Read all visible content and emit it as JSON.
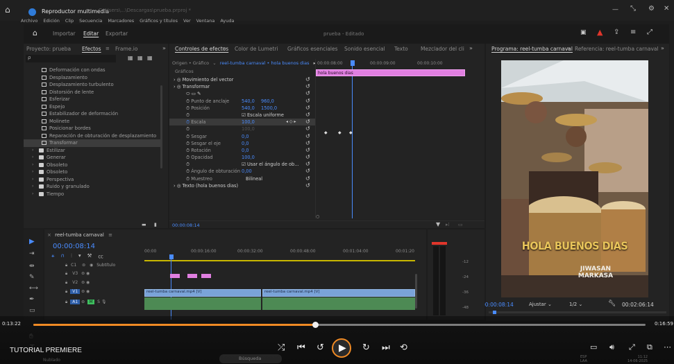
{
  "window": {
    "title": "Reproductor multimedia",
    "background_path": "C:\\Users\\...\\Descargas\\prueba.prproj *"
  },
  "menu": [
    "Archivo",
    "Edición",
    "Clip",
    "Secuencia",
    "Marcadores",
    "Gráficos y títulos",
    "Ver",
    "Ventana",
    "Ayuda"
  ],
  "header": {
    "tabs": [
      "Importar",
      "Editar",
      "Exportar"
    ],
    "active_tab": "Editar",
    "project_title": "prueba",
    "project_status": "- Editado"
  },
  "effects_panel": {
    "tabs": [
      "Proyecto: prueba",
      "Efectos",
      "Frame.io"
    ],
    "search_glyph": "ρ",
    "items": [
      {
        "label": "Deformación con ondas",
        "type": "effect",
        "indent": 2
      },
      {
        "label": "Desplazamiento",
        "type": "effect",
        "indent": 2
      },
      {
        "label": "Desplazamiento turbulento",
        "type": "effect",
        "indent": 2
      },
      {
        "label": "Distorsión de lente",
        "type": "effect",
        "indent": 2
      },
      {
        "label": "Esferizar",
        "type": "effect",
        "indent": 2
      },
      {
        "label": "Espejo",
        "type": "effect",
        "indent": 2
      },
      {
        "label": "Estabilizador de deformación",
        "type": "effect",
        "indent": 2
      },
      {
        "label": "Molinete",
        "type": "effect",
        "indent": 2
      },
      {
        "label": "Posicionar bordes",
        "type": "effect",
        "indent": 2
      },
      {
        "label": "Reparación de obturación de desplazamiento",
        "type": "effect",
        "indent": 2
      },
      {
        "label": "Transformar",
        "type": "effect",
        "indent": 2,
        "selected": true
      },
      {
        "label": "Estilizar",
        "type": "folder",
        "indent": 1
      },
      {
        "label": "Generar",
        "type": "folder",
        "indent": 1
      },
      {
        "label": "Obsoleto",
        "type": "folder",
        "indent": 1
      },
      {
        "label": "Obsoleto",
        "type": "folder",
        "indent": 1
      },
      {
        "label": "Perspectiva",
        "type": "folder",
        "indent": 1
      },
      {
        "label": "Ruido y granulado",
        "type": "folder",
        "indent": 1
      },
      {
        "label": "Tiempo",
        "type": "folder",
        "indent": 1
      }
    ]
  },
  "effect_controls": {
    "tabs": [
      "Controles de efectos",
      "Color de Lumetri",
      "Gráficos esenciales",
      "Sonido esencial",
      "Texto",
      "Mezclador del cli"
    ],
    "source_prefix": "Origen • Gráfico",
    "source_clip": "reel-tumba carnaval • hola buenos dias",
    "section_label": "Gráficos",
    "properties": [
      {
        "label": "Movimiento del vector",
        "level": 0,
        "fx": true
      },
      {
        "label": "Transformar",
        "level": 0,
        "fx": true
      },
      {
        "label": "",
        "level": 1,
        "shapes": true
      },
      {
        "label": "Punto de anclaje",
        "level": 1,
        "value1": "540,0",
        "value2": "960,0"
      },
      {
        "label": "Posición",
        "level": 1,
        "value1": "540,0",
        "value2": "1500,0"
      },
      {
        "label": "",
        "level": 1,
        "checkbox": "Escala uniforme"
      },
      {
        "label": "Escala",
        "level": 1,
        "value1": "100,0",
        "highlight": true
      },
      {
        "label": "",
        "level": 1,
        "value1": "100,0",
        "dim": true
      },
      {
        "label": "Sesgar",
        "level": 1,
        "value1": "0,0"
      },
      {
        "label": "Sesgar el eje",
        "level": 1,
        "value1": "0,0"
      },
      {
        "label": "Rotación",
        "level": 1,
        "value1": "0,0"
      },
      {
        "label": "Opacidad",
        "level": 1,
        "value1": "100,0"
      },
      {
        "label": "",
        "level": 1,
        "checkbox": "Usar el ángulo de ob..."
      },
      {
        "label": "Ángulo de obturación",
        "level": 1,
        "value1": "0,00"
      },
      {
        "label": "Muestreo",
        "level": 1,
        "select": "Bilineal"
      },
      {
        "label": "Texto (hola buenos dias)",
        "level": 0,
        "fx": true
      }
    ],
    "mini_timeline": {
      "times": [
        "00:00:08:00",
        "00:00:09:00",
        "00:00:10:00"
      ],
      "clip_label": "hola buenos dias"
    },
    "timecode": "00:00:08:14"
  },
  "program_monitor": {
    "tabs": [
      "Programa: reel-tumba carnaval",
      "Referencia: reel-tumba carnaval"
    ],
    "overlay_title": "HOLA BUENOS DIAS",
    "logo_line1": "JIWASAN",
    "logo_line2": "MARKASA",
    "timecode": "00:00:08:14",
    "fit": "Ajustar",
    "resolution": "1/2",
    "duration": "00:02:06:14"
  },
  "timeline": {
    "sequence_name": "reel-tumba carnaval",
    "timecode": "00:00:08:14",
    "ruler": [
      "00:00",
      "00:00:16:00",
      "00:00:32:00",
      "00:00:48:00",
      "00:01:04:00",
      "00:01:20"
    ],
    "subtitle_track": "Subtítulo",
    "tracks": [
      {
        "name": "V3"
      },
      {
        "name": "V2"
      },
      {
        "name": "V1"
      },
      {
        "name": "A1",
        "mute": "M",
        "solo": "S"
      }
    ],
    "clip_labels": [
      "reel-tumba carnaval.mp4 [V]",
      "reel-tumba carnaval.mp4 [V]"
    ]
  },
  "audio_meter": {
    "scale": [
      "-12",
      "-24",
      "-36",
      "-48"
    ]
  },
  "player": {
    "current_time": "0:13:22",
    "total_time": "0:16:59",
    "progress": 0.46,
    "title": "TUTORIAL PREMIERE",
    "footer_sub": "Nublado"
  },
  "taskbar": {
    "search_placeholder": "Búsqueda",
    "lang": "ESP",
    "lang2": "LAA",
    "time": "11:12",
    "date": "14-06-2025"
  },
  "colors": {
    "accent_blue": "#4a8cff",
    "clip_pink": "#e07fe0",
    "clip_video": "#7aa3d8",
    "clip_audio": "#4d8a54",
    "title_yellow": "#e8c45a",
    "player_orange": "#f08a24"
  }
}
